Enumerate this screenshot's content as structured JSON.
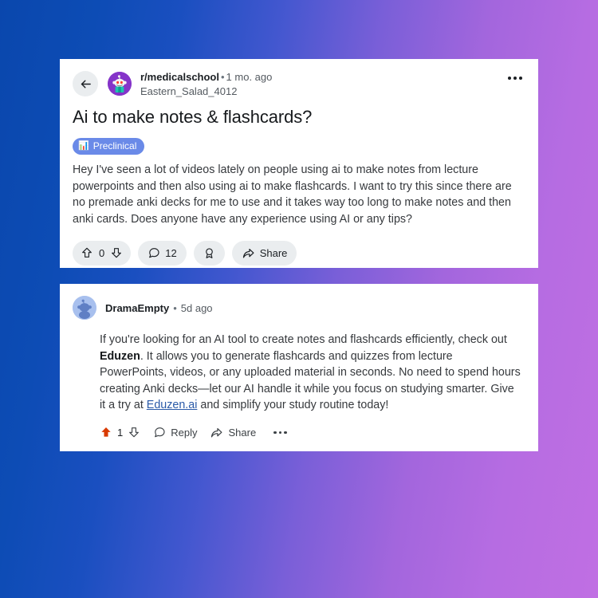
{
  "background": {
    "gradient_from": "#0a47ad",
    "gradient_to": "#c06fe3"
  },
  "post": {
    "back_icon": "arrow-left-icon",
    "subreddit_avatar_icon": "subreddit-snoo-avatar",
    "subreddit": "r/medicalschool",
    "separator": "•",
    "age": "1 mo. ago",
    "author": "Eastern_Salad_4012",
    "overflow_icon": "more-options-icon",
    "title": "Ai to make notes & flashcards?",
    "flair": {
      "icon": "📊",
      "label": "Preclinical",
      "background": "#6a8ae8",
      "text_color": "#ffffff"
    },
    "body": "Hey I've seen a lot of videos lately on people using ai to make notes from lecture powerpoints and then also using ai to make flashcards. I want to try this since there are no premade anki decks for me to use and it takes way too long to make notes and then anki cards. Does anyone have any experience using AI or any tips?",
    "actions": {
      "upvote_icon": "upvote-arrow-icon",
      "score": "0",
      "downvote_icon": "downvote-arrow-icon",
      "comment_icon": "comment-bubble-icon",
      "comment_count": "12",
      "award_icon": "award-rosette-icon",
      "share_icon": "share-arrow-icon",
      "share_label": "Share"
    }
  },
  "comment": {
    "avatar_icon": "user-snoo-avatar",
    "avatar_background": "#a8c0ee",
    "author": "DramaEmpty",
    "separator": "•",
    "age": "5d ago",
    "body_part1": "If you're looking for an AI tool to create notes and flashcards efficiently, check out ",
    "brand": "Eduzen",
    "body_part2": ". It allows you to generate flashcards and quizzes from lecture PowerPoints, videos, or any uploaded material in seconds. No need to spend hours creating Anki decks—let our AI handle it while you focus on studying smarter. Give it a try at ",
    "link_text": "Eduzen.ai",
    "body_part3": " and simplify your study routine today!",
    "link_color": "#2a5aa8",
    "actions": {
      "upvote_icon": "upvote-arrow-filled-icon",
      "upvote_color": "#d93a00",
      "score": "1",
      "downvote_icon": "downvote-arrow-icon",
      "reply_icon": "comment-bubble-icon",
      "reply_label": "Reply",
      "share_icon": "share-arrow-icon",
      "share_label": "Share",
      "overflow_icon": "more-options-icon"
    }
  }
}
